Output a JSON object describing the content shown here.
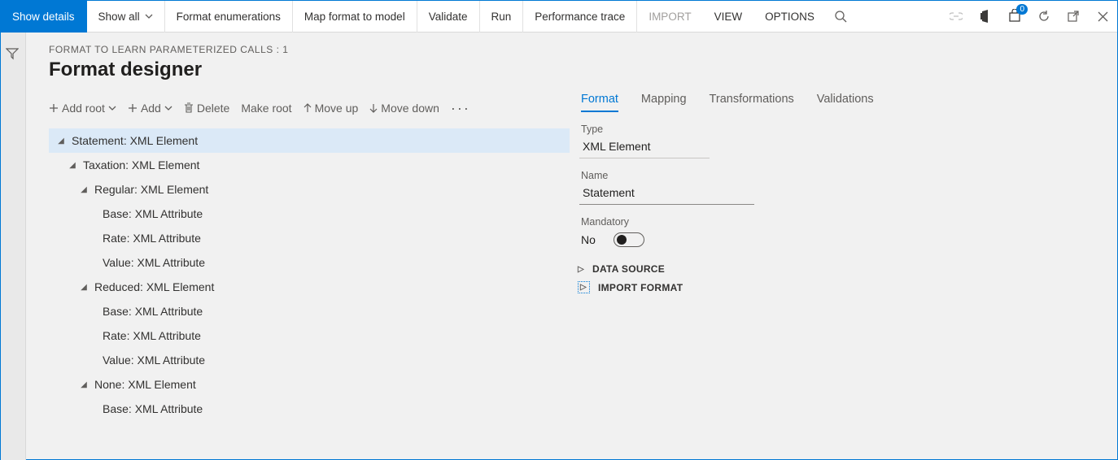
{
  "topbar": {
    "show_details": "Show details",
    "show_all": "Show all",
    "format_enum": "Format enumerations",
    "map_format": "Map format to model",
    "validate": "Validate",
    "run": "Run",
    "perf_trace": "Performance trace",
    "import": "IMPORT",
    "view": "VIEW",
    "options": "OPTIONS",
    "notif_count": "0"
  },
  "breadcrumb": "FORMAT TO LEARN PARAMETERIZED CALLS : 1",
  "page_title": "Format designer",
  "toolbar": {
    "add_root": "Add root",
    "add": "Add",
    "delete": "Delete",
    "make_root": "Make root",
    "move_up": "Move up",
    "move_down": "Move down"
  },
  "tree": {
    "n0": "Statement: XML Element",
    "n1": "Taxation: XML Element",
    "n2": "Regular: XML Element",
    "n3": "Base: XML Attribute",
    "n4": "Rate: XML Attribute",
    "n5": "Value: XML Attribute",
    "n6": "Reduced: XML Element",
    "n7": "Base: XML Attribute",
    "n8": "Rate: XML Attribute",
    "n9": "Value: XML Attribute",
    "n10": "None: XML Element",
    "n11": "Base: XML Attribute"
  },
  "tabs": {
    "format": "Format",
    "mapping": "Mapping",
    "transformations": "Transformations",
    "validations": "Validations"
  },
  "form": {
    "type_label": "Type",
    "type_value": "XML Element",
    "name_label": "Name",
    "name_value": "Statement",
    "mandatory_label": "Mandatory",
    "mandatory_value": "No"
  },
  "sections": {
    "data_source": "DATA SOURCE",
    "import_format": "IMPORT FORMAT"
  }
}
